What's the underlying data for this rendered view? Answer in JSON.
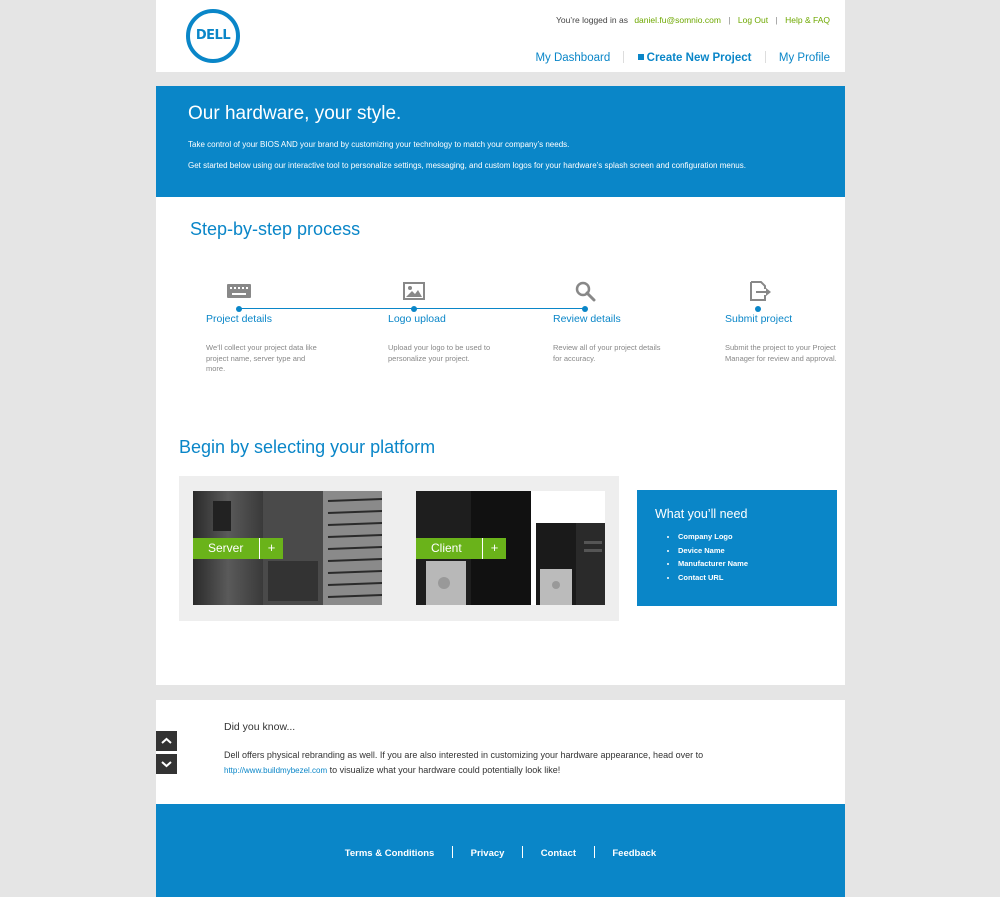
{
  "header": {
    "logo_text": "DELL",
    "logged_in_label": "You’re logged in as",
    "email": "daniel.fu@somnio.com",
    "logout": "Log Out",
    "help": "Help & FAQ",
    "nav": [
      {
        "label": "My Dashboard",
        "active": false
      },
      {
        "label": "Create New Project",
        "active": true
      },
      {
        "label": "My Profile",
        "active": false
      }
    ]
  },
  "hero": {
    "title": "Our hardware, your style.",
    "line1": "Take control of your BIOS AND your brand by customizing your technology to match your company’s needs.",
    "line2": "Get started below using our interactive tool to personalize settings, messaging, and custom logos for your hardware’s splash screen and configuration menus."
  },
  "steps_section": {
    "title": "Step-by-step process",
    "steps": [
      {
        "title": "Project details",
        "desc": "We’ll collect your project data like project name, server type and more.",
        "icon": "keyboard-icon"
      },
      {
        "title": "Logo upload",
        "desc": "Upload your logo to be used to personalize your project.",
        "icon": "image-icon"
      },
      {
        "title": "Review details",
        "desc": "Review all of your project details for accuracy.",
        "icon": "magnifier-icon"
      },
      {
        "title": "Submit project",
        "desc": "Submit the project to your Project Manager for review and approval.",
        "icon": "export-icon"
      }
    ]
  },
  "platform_section": {
    "title": "Begin by selecting your platform",
    "server_label": "Server",
    "client_label": "Client",
    "plus": "+"
  },
  "need": {
    "title": "What you’ll need",
    "items": [
      "Company Logo",
      "Device Name",
      "Manufacturer Name",
      "Contact URL"
    ]
  },
  "did_you_know": {
    "title": "Did you know...",
    "text_before": "Dell offers physical rebranding as well. If you are also interested in customizing your hardware appearance, head over to",
    "link": "http://www.buildmybezel.com",
    "text_after": "to visualize what your hardware could potentially look like!"
  },
  "footer": {
    "links": [
      "Terms & Conditions",
      "Privacy",
      "Contact",
      "Feedback"
    ]
  },
  "colors": {
    "brand_blue": "#0a86c8",
    "accent_green": "#6ab31a"
  }
}
